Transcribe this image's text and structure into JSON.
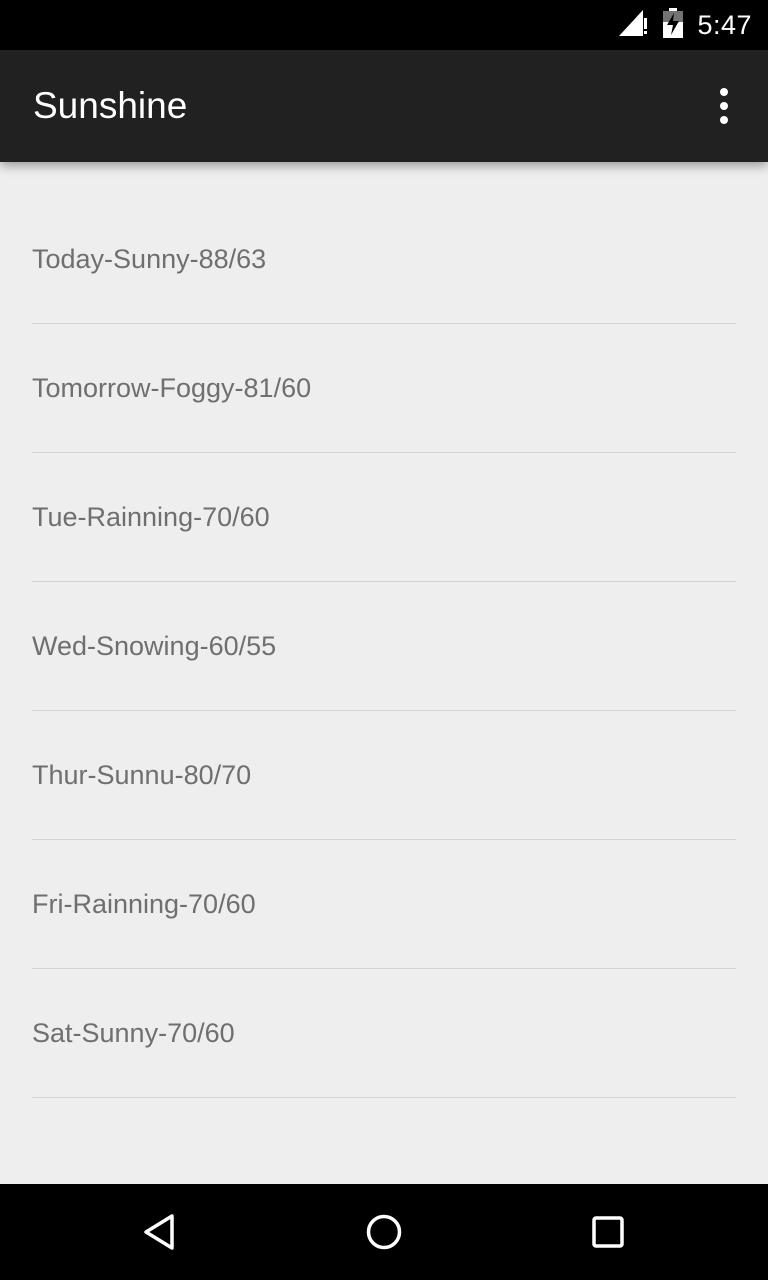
{
  "status_bar": {
    "time": "5:47",
    "icons": [
      "signal-icon",
      "battery-charging-icon"
    ]
  },
  "app_bar": {
    "title": "Sunshine",
    "overflow_icon": "more-vert-icon"
  },
  "forecast": {
    "items": [
      {
        "label": "Today-Sunny-88/63"
      },
      {
        "label": "Tomorrow-Foggy-81/60"
      },
      {
        "label": "Tue-Rainning-70/60"
      },
      {
        "label": "Wed-Snowing-60/55"
      },
      {
        "label": "Thur-Sunnu-80/70"
      },
      {
        "label": "Fri-Rainning-70/60"
      },
      {
        "label": "Sat-Sunny-70/60"
      }
    ]
  },
  "nav_bar": {
    "buttons": [
      "back-icon",
      "home-icon",
      "recents-icon"
    ]
  },
  "colors": {
    "app_bar_bg": "#212121",
    "content_bg": "#eeeeee",
    "item_text": "#6f6f6f",
    "divider": "#d2d2d2"
  }
}
